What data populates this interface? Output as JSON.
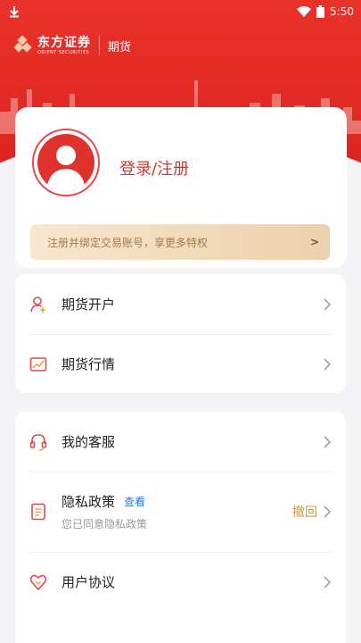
{
  "status_bar": {
    "time": "5:50"
  },
  "brand": {
    "name": "东方证券",
    "sub": "ORIENT SECURITIES",
    "module": "期货"
  },
  "profile": {
    "login_label": "登录/注册",
    "banner_text": "注册并绑定交易账号，享更多特权",
    "banner_arrow": ">"
  },
  "menu_group_1": [
    {
      "title": "期货开户",
      "icon": "user-add-icon"
    },
    {
      "title": "期货行情",
      "icon": "chart-icon"
    }
  ],
  "menu_group_2": {
    "service": {
      "title": "我的客服",
      "icon": "headset-icon"
    },
    "privacy": {
      "title": "隐私政策",
      "link": "查看",
      "subtitle": "您已同意隐私政策",
      "action": "撤回",
      "icon": "document-icon"
    },
    "agreement": {
      "title": "用户协议",
      "icon": "heart-icon"
    }
  },
  "colors": {
    "brand_red": "#e8322a",
    "gold": "#c99a4f",
    "link_blue": "#2a78e4"
  }
}
